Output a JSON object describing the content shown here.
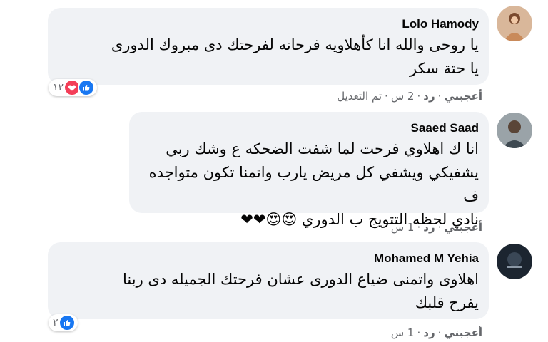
{
  "comments": [
    {
      "author": "Lolo Hamody",
      "text_lines": [
        "يا روحى والله انا كأهلاويه فرحانه لفرحتك دى مبروك الدورى",
        "يا حتة سكر"
      ],
      "reaction_count": "١٢",
      "reactions": [
        "like",
        "love"
      ],
      "actions": {
        "like": "أعجبني",
        "reply": "رد",
        "time": "2 س",
        "edited": "تم التعديل"
      }
    },
    {
      "author": "Saaed Saad",
      "text_lines": [
        "انا ك اهلاوي فرحت لما شفت الضحكه ع وشك ربي",
        "يشفيكي ويشفي كل مريض يارب واتمنا تكون متواجده ف",
        "نادي لحظه التتويج ب الدوري 😍😍❤❤"
      ],
      "actions": {
        "like": "أعجبني",
        "reply": "رد",
        "time": "1 س"
      }
    },
    {
      "author": "Mohamed M Yehia",
      "text_lines": [
        "اهلاوى واتمنى ضياع الدورى عشان فرحتك الجميله دى ربنا",
        "يفرح قلبك"
      ],
      "reaction_count": "٢",
      "reactions": [
        "like"
      ],
      "actions": {
        "like": "أعجبني",
        "reply": "رد",
        "time": "1 س"
      }
    }
  ],
  "separator": "·"
}
